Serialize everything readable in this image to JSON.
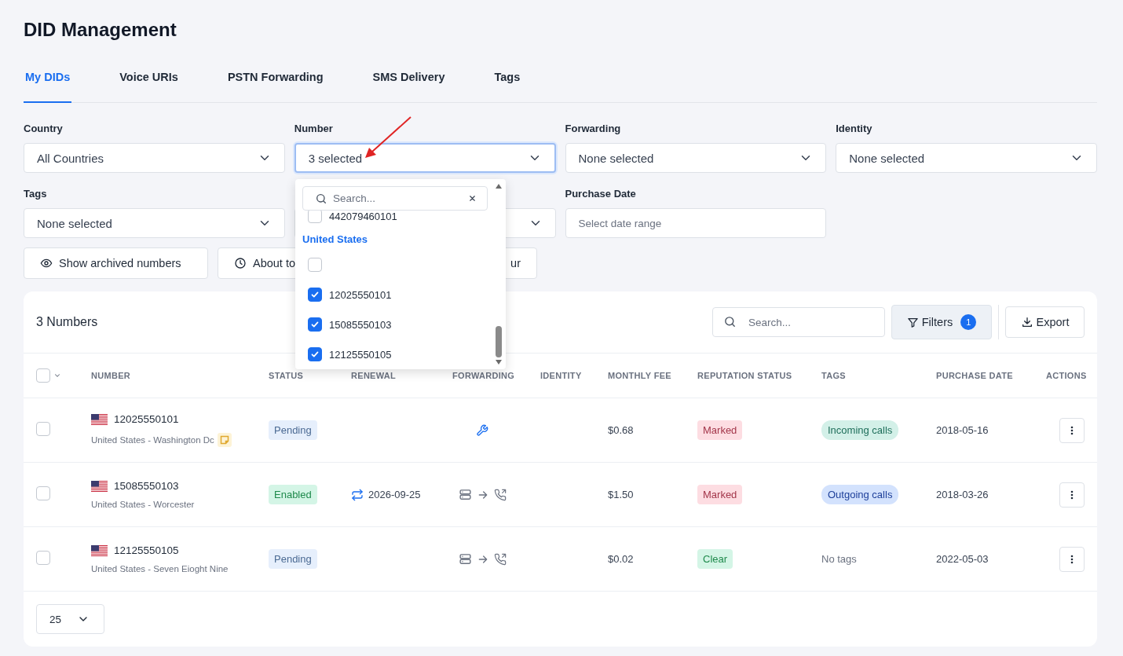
{
  "page_title": "DID Management",
  "tabs": [
    {
      "label": "My DIDs",
      "selected": true
    },
    {
      "label": "Voice URIs",
      "selected": false
    },
    {
      "label": "PSTN Forwarding",
      "selected": false
    },
    {
      "label": "SMS Delivery",
      "selected": false
    },
    {
      "label": "Tags",
      "selected": false
    }
  ],
  "filters": [
    {
      "label": "Country",
      "value": "All Countries",
      "kind": "select",
      "focused": false
    },
    {
      "label": "Number",
      "value": "3 selected",
      "kind": "select",
      "focused": true
    },
    {
      "label": "Forwarding",
      "value": "None selected",
      "kind": "select",
      "focused": false
    },
    {
      "label": "Identity",
      "value": "None selected",
      "kind": "select",
      "focused": false
    },
    {
      "label": "Tags",
      "value": "None selected",
      "kind": "select",
      "focused": false
    },
    {
      "kind": "select",
      "focused": false
    },
    {
      "label": "Purchase Date",
      "placeholder": "Select date range",
      "kind": "date"
    }
  ],
  "quick_buttons": [
    {
      "label": "Show archived numbers",
      "kind": "archived"
    },
    {
      "label": "About to",
      "kind": "expiring"
    },
    {
      "label": "ur",
      "kind": "other"
    }
  ],
  "annotation": {
    "kind": "arrow"
  },
  "number_dropdown": {
    "search_placeholder": "Search...",
    "groups": [
      {
        "options": [
          {
            "label": "442079460101",
            "checked": false
          }
        ]
      },
      {
        "label": "United States",
        "options": [
          {
            "checked": false
          },
          {
            "label": "12025550101",
            "checked": true
          },
          {
            "label": "15085550103",
            "checked": true
          },
          {
            "label": "12125550105",
            "checked": true
          }
        ]
      }
    ]
  },
  "table": {
    "count": "3 Numbers",
    "search_placeholder": "Search...",
    "filters_button": "Filters",
    "filters_count": "1",
    "export_button": "Export",
    "select_all": {
      "checked": false
    },
    "columns": [
      "NUMBER",
      "STATUS",
      "RENEWAL",
      "FORWARDING",
      "IDENTITY",
      "MONTHLY FEE",
      "REPUTATION STATUS",
      "TAGS",
      "PURCHASE DATE",
      "ACTIONS"
    ],
    "rows": [
      {
        "checked": false,
        "number": "12025550101",
        "location": "United States - Washington Dc",
        "has_note": true,
        "status": {
          "label": "Pending",
          "kind": "pending"
        },
        "forwarding": {
          "kind": "configure"
        },
        "monthly_fee": "$0.68",
        "reputation": {
          "label": "Marked",
          "kind": "marked"
        },
        "tag": {
          "label": "Incoming calls",
          "kind": "incoming"
        },
        "purchase_date": "2018-05-16"
      },
      {
        "checked": false,
        "number": "15085550103",
        "location": "United States - Worcester",
        "has_note": false,
        "status": {
          "label": "Enabled",
          "kind": "enabled"
        },
        "renewal": "2026-09-25",
        "forwarding": {
          "kind": "route"
        },
        "monthly_fee": "$1.50",
        "reputation": {
          "label": "Marked",
          "kind": "marked"
        },
        "tag": {
          "label": "Outgoing calls",
          "kind": "outgoing"
        },
        "purchase_date": "2018-03-26"
      },
      {
        "checked": false,
        "number": "12125550105",
        "location": "United States - Seven Eioght Nine",
        "has_note": false,
        "status": {
          "label": "Pending",
          "kind": "pending"
        },
        "forwarding": {
          "kind": "route"
        },
        "monthly_fee": "$0.02",
        "reputation": {
          "label": "Clear",
          "kind": "clear"
        },
        "tag": {
          "label": "No tags",
          "kind": "none"
        },
        "purchase_date": "2022-05-03"
      }
    ],
    "page_size": "25"
  }
}
